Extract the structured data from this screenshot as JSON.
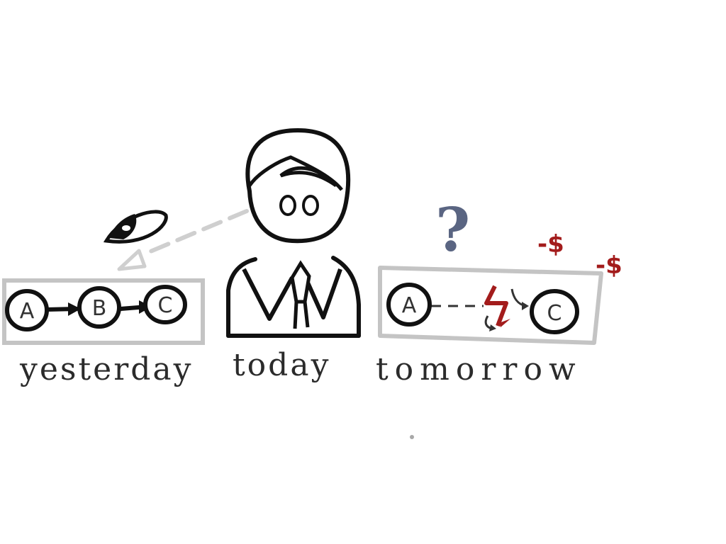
{
  "captions": {
    "yesterday": "yesterday",
    "today": "today",
    "tomorrow": "tomorrow"
  },
  "yesterday_nodes": [
    "A",
    "B",
    "C"
  ],
  "tomorrow_nodes": [
    "A",
    "C"
  ],
  "question_mark": "?",
  "cost_marks": [
    "-$",
    "-$"
  ],
  "colors": {
    "ink": "#111111",
    "frame": "#c4c4c4",
    "gaze": "#cfcfcf",
    "cost": "#a31c1c",
    "question": "#5a6582"
  },
  "icons": [
    "eye-icon",
    "worried-person-icon",
    "broken-link-icon",
    "question-mark-icon"
  ]
}
